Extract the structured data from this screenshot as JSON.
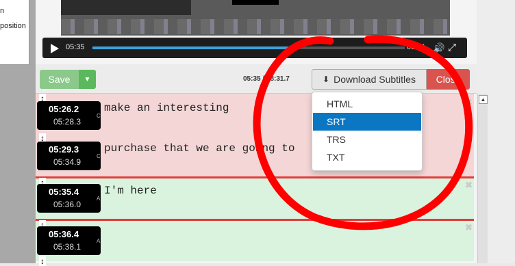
{
  "left_panel": {
    "text_lines": [
      "n",
      "position"
    ]
  },
  "player": {
    "current_time": "05:35",
    "duration": "08:31",
    "progress_fraction": 0.64
  },
  "toolbar": {
    "save_label": "Save",
    "time_display": "05:35 / 08:31.7",
    "download_label": "Download Subtitles",
    "close_label": "Close"
  },
  "dropdown": {
    "items": [
      "HTML",
      "SRT",
      "TRS",
      "TXT"
    ],
    "selected": "SRT"
  },
  "subtitles": [
    {
      "start": "05:26.2",
      "end": "05:28.3",
      "speaker": "C",
      "text": "make an interesting"
    },
    {
      "start": "05:29.3",
      "end": "05:34.9",
      "speaker": "C",
      "text": "purchase that we are going to "
    },
    {
      "start": "05:35.4",
      "end": "05:36.0",
      "speaker": "A",
      "text": "I'm here"
    },
    {
      "start": "05:36.4",
      "end": "05:38.1",
      "speaker": "A",
      "text": ""
    }
  ],
  "colors": {
    "annotation": "#ff0000",
    "save": "#5cb85c",
    "close": "#d9534f",
    "selected": "#0b77c2"
  },
  "icons": {
    "play": "play-icon",
    "volume": "volume-icon",
    "fullscreen": "fullscreen-icon",
    "download": "download-icon",
    "caret": "caret-down-icon",
    "remove": "remove-icon",
    "drag": "resize-vertical-icon"
  }
}
